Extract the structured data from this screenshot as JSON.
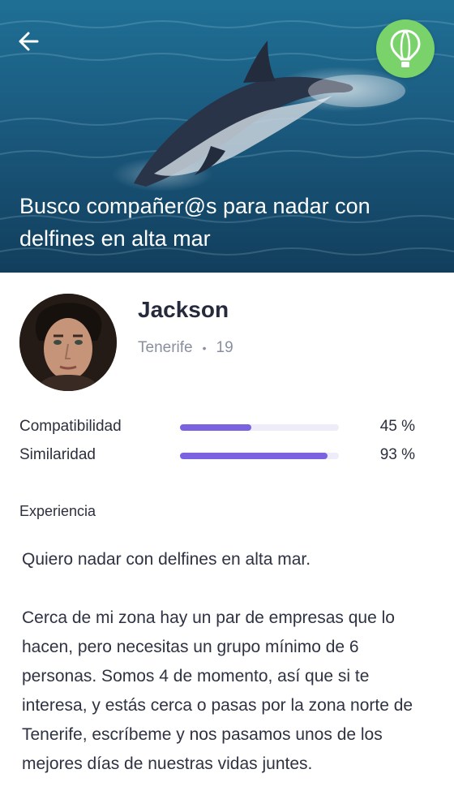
{
  "header": {
    "back_icon": "arrow-left-icon",
    "balloon_icon": "hot-air-balloon-icon",
    "accent_color": "#79d36a",
    "title": "Busco compañer@s para nadar con delfines en alta mar"
  },
  "profile": {
    "name": "Jackson",
    "location": "Tenerife",
    "separator": "•",
    "age": "19"
  },
  "stats": [
    {
      "label": "Compatibilidad",
      "value": "45 %",
      "fill": 0.45
    },
    {
      "label": "Similaridad",
      "value": "93 %",
      "fill": 0.93
    }
  ],
  "bar_color": "#7a62e0",
  "experience": {
    "label": "Experiencia",
    "paragraphs": [
      "Quiero nadar con delfines en alta mar.",
      "Cerca de mi zona hay un par de empresas que lo hacen, pero necesitas un grupo mínimo de 6 personas. Somos 4 de momento, así que si te interesa, y estás cerca o pasas por la zona norte de Tenerife, escríbeme y nos pasamos unos de los mejores días de nuestras vidas juntes."
    ]
  }
}
